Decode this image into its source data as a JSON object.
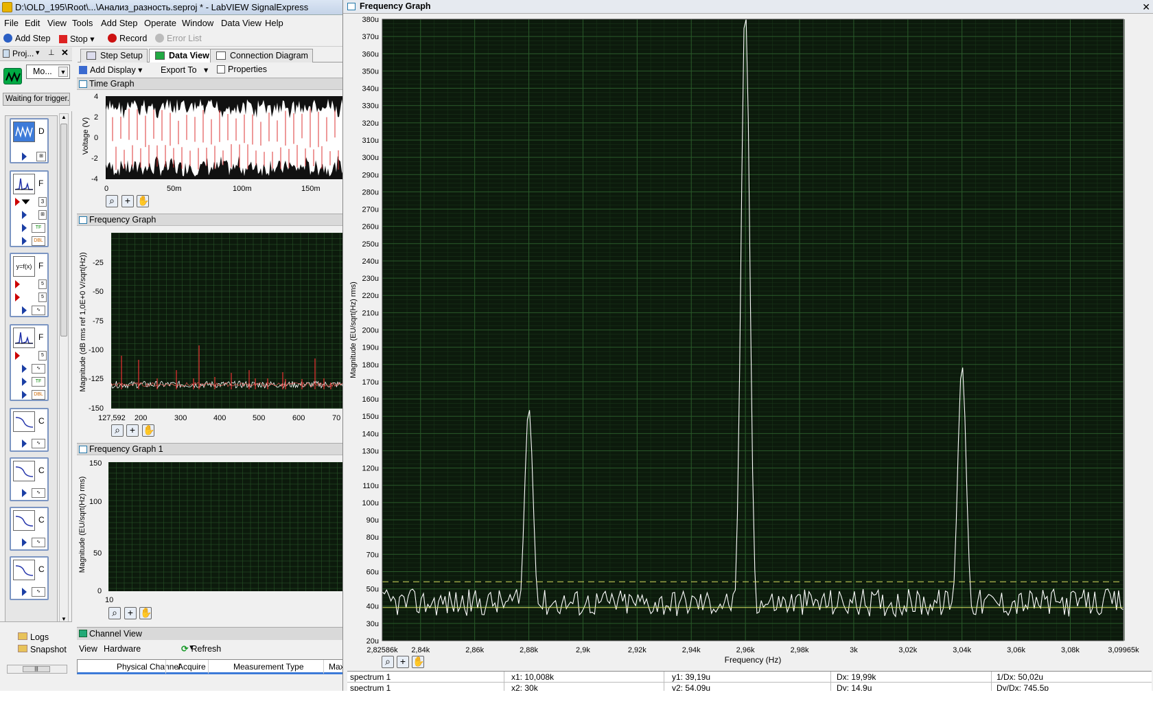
{
  "window": {
    "title": "D:\\OLD_195\\Root\\...\\Анализ_разность.seproj * - LabVIEW SignalExpress"
  },
  "menu": [
    "File",
    "Edit",
    "View",
    "Tools",
    "Add Step",
    "Operate",
    "Window",
    "Data View",
    "Help"
  ],
  "toolbar": {
    "add_step": "Add Step",
    "stop": "Stop",
    "record": "Record",
    "error_list": "Error List"
  },
  "project": {
    "header": "Proj...",
    "mode_select": "Mo...",
    "status": "Waiting for trigger..."
  },
  "tabs": [
    "Step Setup",
    "Data View",
    "Connection Diagram"
  ],
  "view_toolbar": {
    "add_display": "Add Display",
    "export_to": "Export To",
    "properties": "Properties"
  },
  "time_graph": {
    "title": "Time Graph",
    "ylabel": "Voltage (V)",
    "yticks": [
      "4",
      "2",
      "0",
      "-2",
      "-4"
    ],
    "xticks": [
      "0",
      "50m",
      "100m",
      "150m"
    ]
  },
  "freq_graph_small": {
    "title": "Frequency Graph",
    "ylabel": "Magnitude (dB rms ref 1,0E+0 V/sqrt(Hz))",
    "yticks": [
      "-25",
      "-50",
      "-75",
      "-100",
      "-125",
      "-150"
    ],
    "xticks": [
      "127,592",
      "200",
      "300",
      "400",
      "500",
      "600",
      "70"
    ]
  },
  "freq_graph_1": {
    "title": "Frequency Graph 1",
    "ylabel": "Magnitude (EU/sqrt(Hz) rms)",
    "yticks": [
      "150",
      "100",
      "50",
      "0"
    ],
    "xticks": [
      "10"
    ]
  },
  "bottom_left": {
    "logs": "Logs",
    "snapshot": "Snapshot"
  },
  "channel_view": {
    "title": "Channel View",
    "view_label": "View",
    "view_value": "Hardware",
    "refresh": "Refresh",
    "columns": [
      "Physical Channel",
      "Acquire",
      "Measurement Type",
      "Max"
    ]
  },
  "main_graph": {
    "window_title": "Frequency Graph",
    "xlabel": "Frequency (Hz)",
    "ylabel": "Magnitude (EU/sqrt(Hz) rms)",
    "yticks": [
      "380u",
      "370u",
      "360u",
      "350u",
      "340u",
      "330u",
      "320u",
      "310u",
      "300u",
      "290u",
      "280u",
      "270u",
      "260u",
      "250u",
      "240u",
      "230u",
      "220u",
      "210u",
      "200u",
      "190u",
      "180u",
      "170u",
      "160u",
      "150u",
      "140u",
      "130u",
      "120u",
      "110u",
      "100u",
      "90u",
      "80u",
      "70u",
      "60u",
      "50u",
      "40u",
      "30u",
      "20u"
    ],
    "xticks": [
      "2,82586k",
      "2,84k",
      "2,86k",
      "2,88k",
      "2,9k",
      "2,92k",
      "2,94k",
      "2,96k",
      "2,98k",
      "3k",
      "3,02k",
      "3,04k",
      "3,06k",
      "3,08k",
      "3,09965k"
    ]
  },
  "cursor_table": {
    "rows": [
      [
        "spectrum 1",
        "x1: 10,008k",
        "y1: 39,19u",
        "Dx: 19,99k",
        "1/Dx: 50,02u"
      ],
      [
        "spectrum 1",
        "x2: 30k",
        "y2: 54,09u",
        "Dy: 14,9u",
        "Dy/Dx: 745,5p"
      ]
    ]
  },
  "chart_data": {
    "type": "line",
    "title": "Frequency Graph",
    "xlabel": "Frequency (Hz)",
    "ylabel": "Magnitude (EU/sqrt(Hz) rms)",
    "xlim": [
      2825.86,
      3099.65
    ],
    "ylim": [
      20,
      380
    ],
    "grid": true,
    "peaks": [
      {
        "x": 2880,
        "y": 130
      },
      {
        "x": 2960,
        "y": 370
      },
      {
        "x": 3040,
        "y": 155
      }
    ],
    "noise_floor_approx": 42,
    "cursor_lines": [
      {
        "y": 39.19,
        "style": "solid"
      },
      {
        "y": 54.09,
        "style": "dashed"
      }
    ]
  },
  "colors": {
    "plot_bg": "#0c1a0c",
    "grid": "#2a5a2a",
    "trace": "#ffffff",
    "cursor": "#d8e060"
  }
}
